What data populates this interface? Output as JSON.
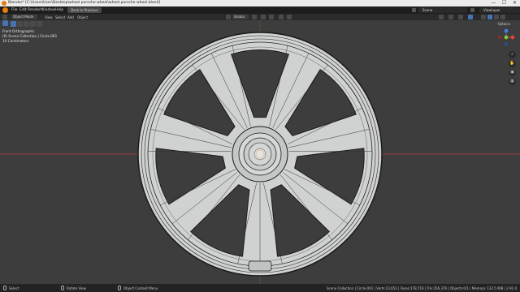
{
  "window": {
    "title": "Blender* [C:\\Users\\User\\Desktop\\wheel porsche wheel\\wheel porsche wheel.blend]",
    "controls": [
      "—",
      "☐",
      "✕"
    ]
  },
  "menubar": {
    "items": [
      "File",
      "Edit",
      "Render",
      "Window",
      "Help"
    ],
    "back_button": "Back to Previous",
    "scene": "Scene",
    "view_layer": "ViewLayer"
  },
  "header": {
    "mode": "Object Mode",
    "menus": [
      "View",
      "Select",
      "Add",
      "Object"
    ],
    "transform_orientation": "Global"
  },
  "viewport": {
    "view_name": "Front Orthographic",
    "collection_info": "(0) Scene Collection | Circle.061",
    "scale_info": "10 Centimeters",
    "options_label": "Options"
  },
  "gizmo_axes": {
    "x_color": "#e0453b",
    "y_color": "#8ac43d",
    "z_color": "#3f7fe6"
  },
  "colors": {
    "accent": "#4772b3",
    "axis_red": "#b43a3a",
    "axis_green": "#5d8f2b",
    "mesh_fill": "#cfd2d0",
    "wire": "#1a1a1a"
  },
  "statusbar": {
    "left": "Select",
    "middle": "Rotate View",
    "right_hint": "Object Context Menu",
    "stats": "Scene Collection | Circle.061 | Verts:23,653 | Faces:178,716 | Tris:356,376 | Objects:0/1 | Memory: 132.5 MiB | 2.91.0"
  }
}
